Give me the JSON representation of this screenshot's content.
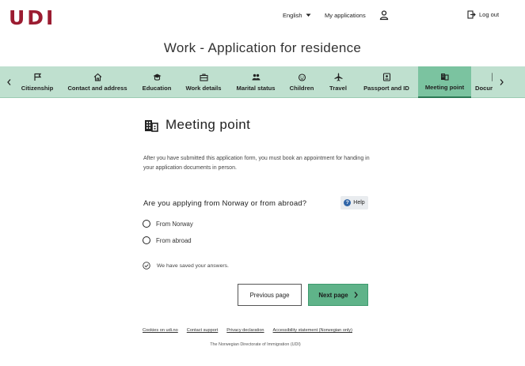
{
  "header": {
    "logo": "UDI",
    "language": "English",
    "my_applications": "My applications",
    "log_out": "Log out"
  },
  "page_title": "Work - Application for residence",
  "steps": [
    {
      "label": "Citizenship",
      "icon": "flag-icon"
    },
    {
      "label": "Contact and address",
      "icon": "home-icon"
    },
    {
      "label": "Education",
      "icon": "graduation-cap-icon"
    },
    {
      "label": "Work details",
      "icon": "briefcase-icon"
    },
    {
      "label": "Marital status",
      "icon": "people-icon"
    },
    {
      "label": "Children",
      "icon": "child-face-icon"
    },
    {
      "label": "Travel",
      "icon": "airplane-icon"
    },
    {
      "label": "Passport and ID",
      "icon": "id-card-icon"
    },
    {
      "label": "Meeting point",
      "icon": "building-icon",
      "active": true
    },
    {
      "label": "Documents",
      "icon": "document-icon"
    }
  ],
  "main": {
    "title": "Meeting point",
    "intro": "After you have submitted this application form, you must book an appointment for handing in your application documents in person.",
    "question": "Are you applying from Norway or from abroad?",
    "help_label": "Help",
    "options": [
      "From Norway",
      "From abroad"
    ],
    "saved_text": "We have saved your answers.",
    "previous_button": "Previous page",
    "next_button": "Next page"
  },
  "footer": {
    "links": [
      "Cookies on udi.no",
      "Contact support",
      "Privacy declaration",
      "Accessibility statement (Norwegian only)"
    ],
    "note": "The Norwegian Directorate of Immigration (UDI)"
  },
  "colors": {
    "brand": "#9b1c31",
    "stepbar": "#bfe0cf",
    "step_active": "#7bc3a0",
    "next_button": "#5fb389"
  }
}
